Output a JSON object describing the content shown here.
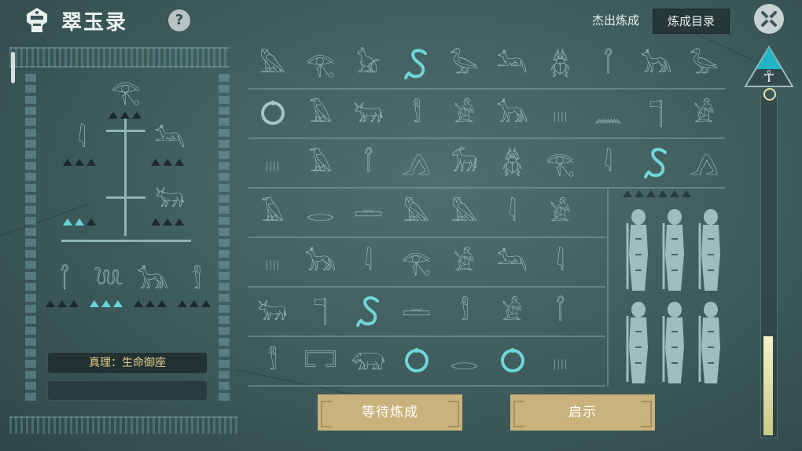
{
  "app": {
    "title": "翠玉录",
    "help_icon": "?"
  },
  "header": {
    "best_label": "杰出炼成",
    "catalog_button": "炼成目录"
  },
  "tree": {
    "truth_text": "真理：生命御座",
    "nodes": [
      {
        "id": "eye",
        "glyph": "𓂀",
        "lit": false,
        "tri_total": 3,
        "tri_lit": 0
      },
      {
        "id": "reeds",
        "glyph": "𓇋",
        "lit": false,
        "tri_total": 3,
        "tri_lit": 0
      },
      {
        "id": "anubis",
        "glyph": "𓃢",
        "lit": false,
        "tri_total": 3,
        "tri_lit": 0
      },
      {
        "id": "ring",
        "glyph": "○",
        "lit": false,
        "tri_total": 3,
        "tri_lit": 2
      },
      {
        "id": "bull",
        "glyph": "𓃒",
        "lit": false,
        "tri_total": 3,
        "tri_lit": 0
      },
      {
        "id": "staff-cross",
        "glyph": "𓋾",
        "lit": false,
        "tri_total": 3,
        "tri_lit": 0
      },
      {
        "id": "serpent",
        "glyph": "𓆙",
        "lit": false,
        "tri_total": 3,
        "tri_lit": 3
      },
      {
        "id": "jackal",
        "glyph": "𓃥",
        "lit": false,
        "tri_total": 3,
        "tri_lit": 0
      },
      {
        "id": "mummy",
        "glyph": "𓀾",
        "lit": false,
        "tri_total": 3,
        "tri_lit": 0
      }
    ]
  },
  "grid": {
    "rows": [
      [
        "𓅓",
        "𓂀",
        "𓃠",
        "S",
        "𓅭",
        "𓃢",
        "𓆣",
        "𓋾",
        "𓃥",
        "𓅭"
      ],
      [
        "○",
        "𓄿",
        "𓃒",
        "𓀾",
        "𓀀",
        "𓃥",
        "𓏽",
        "𓈖",
        "𓊹",
        "𓀀"
      ],
      [
        "𓏽",
        "𓄿",
        "𓋾",
        "𓂻",
        "𓃘",
        "𓆣",
        "𓂀",
        "𓇋",
        "S",
        "𓂻"
      ],
      [
        "𓄿",
        "𓂋",
        "𓏛",
        "𓅓",
        "𓅓",
        "𓇋",
        "𓀀"
      ],
      [
        "𓏽",
        "𓃥",
        "𓇋",
        "𓂀",
        "𓀀",
        "𓃢",
        "𓇋"
      ],
      [
        "𓃒",
        "𓊹",
        "S",
        "𓏛",
        "𓀾",
        "𓀀",
        "𓋾"
      ],
      [
        "𓀾",
        "𓉐",
        "𓃯",
        "○",
        "𓂋",
        "○",
        "𓏽"
      ]
    ],
    "lit": [
      [
        0,
        3
      ],
      [
        2,
        8
      ],
      [
        5,
        2
      ],
      [
        6,
        3
      ],
      [
        6,
        5
      ]
    ]
  },
  "side_panel": {
    "figures": 6,
    "tri_total": 6
  },
  "buttons": {
    "wait": "等待炼成",
    "hint": "启示"
  },
  "gauge": {
    "level_fraction": 0.29,
    "top_symbol": "☥"
  },
  "colors": {
    "accent": "#6fd6dc",
    "gold": "#c9b27c",
    "background": "#43605f"
  }
}
